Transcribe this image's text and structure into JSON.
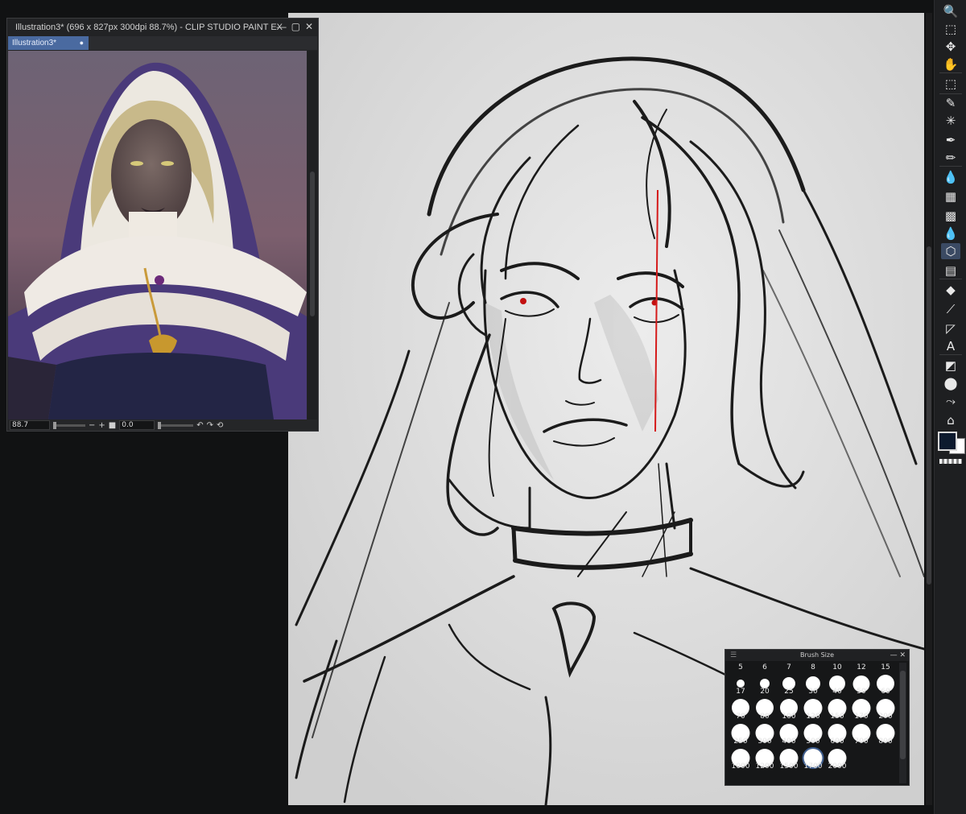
{
  "app": {
    "window_title": "Illustration3* (696 x 827px 300dpi 88.7%)  - CLIP STUDIO PAINT EX",
    "tab_label": "Illustration3*",
    "tab_modified_marker": "●",
    "window_buttons": [
      "—",
      "▢",
      "✕"
    ]
  },
  "navigator": {
    "zoom_value": "88.7",
    "rotation_value": "0.0",
    "zoom_out_label": "−",
    "zoom_in_label": "+",
    "fit_label": "■",
    "rotate_left_label": "↶",
    "rotate_right_label": "↷",
    "reset_label": "⟲"
  },
  "brush_size": {
    "title": "Brush Size",
    "menu_glyph": "☰",
    "window_buttons": [
      "—",
      "✕"
    ],
    "top_row": [
      "5",
      "6",
      "7",
      "8",
      "10",
      "12",
      "15"
    ],
    "rows": [
      [
        "17",
        "20",
        "25",
        "30",
        "40",
        "50",
        "60"
      ],
      [
        "70",
        "80",
        "100",
        "120",
        "150",
        "170",
        "200"
      ],
      [
        "250",
        "300",
        "400",
        "500",
        "600",
        "700",
        "800"
      ],
      [
        "1000",
        "1200",
        "1500",
        "1700",
        "2000"
      ]
    ],
    "selected": "1700"
  },
  "toolbar": {
    "tools": [
      {
        "name": "zoom-icon",
        "glyph": "🔍"
      },
      {
        "name": "operation-icon",
        "glyph": "⬚"
      },
      {
        "name": "move-layer-icon",
        "glyph": "✥"
      },
      {
        "name": "hand-icon",
        "glyph": "✋"
      },
      {
        "name": "selection-icon",
        "glyph": "⬚"
      },
      {
        "name": "eyedropper-icon",
        "glyph": "✎"
      },
      {
        "name": "auto-select-icon",
        "glyph": "✳"
      },
      {
        "name": "pen-icon",
        "glyph": "✒"
      },
      {
        "name": "pencil-icon",
        "glyph": "✏"
      },
      {
        "name": "brush-icon",
        "glyph": "💧"
      },
      {
        "name": "airbrush-icon",
        "glyph": "▦"
      },
      {
        "name": "decoration-icon",
        "glyph": "▩"
      },
      {
        "name": "blend-icon",
        "glyph": "💧"
      },
      {
        "name": "figure-icon",
        "glyph": "⬡"
      },
      {
        "name": "frame-border-icon",
        "glyph": "▤"
      },
      {
        "name": "eraser-icon",
        "glyph": "◆"
      },
      {
        "name": "ruler-icon",
        "glyph": "⟋"
      },
      {
        "name": "line-correction-icon",
        "glyph": "◸"
      },
      {
        "name": "text-icon",
        "glyph": "A"
      },
      {
        "name": "gradient-icon",
        "glyph": "◩"
      },
      {
        "name": "fill-icon",
        "glyph": "⬤"
      },
      {
        "name": "correct-line-icon",
        "glyph": "⤳"
      },
      {
        "name": "balloon-icon",
        "glyph": "⌂"
      }
    ],
    "active_tool": "figure-icon",
    "main_color": "#0d1a2e",
    "sub_color": "#ffffff"
  }
}
